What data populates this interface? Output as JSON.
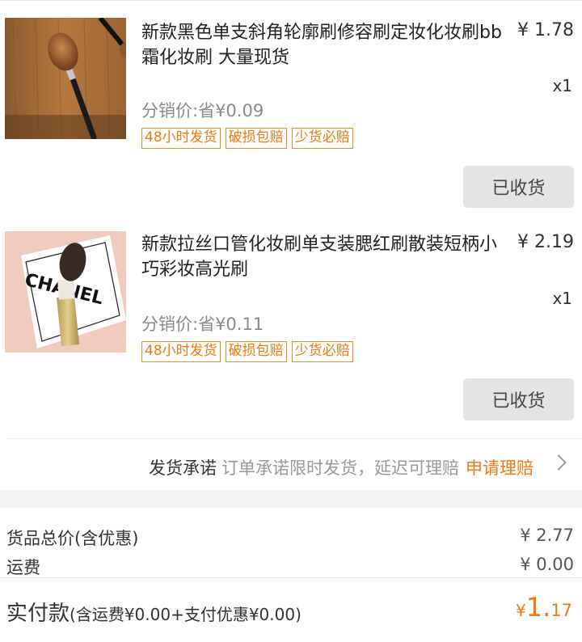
{
  "items": [
    {
      "title": "新款黑色单支斜角轮廓刷修容刷定妆化妆刷bb霜化妆刷 大量现货",
      "price": "¥ 1.78",
      "qty": "x1",
      "commission": "分销价:省¥0.09",
      "badges": [
        "48小时发货",
        "破损包赔",
        "少货必赔"
      ],
      "action": "已收货"
    },
    {
      "title": "新款拉丝口管化妆刷单支装腮红刷散装短柄小巧彩妆高光刷",
      "price": "¥ 2.19",
      "qty": "x1",
      "commission": "分销价:省¥0.11",
      "badges": [
        "48小时发货",
        "破损包赔",
        "少货必赔"
      ],
      "action": "已收货",
      "image_text": "CHANEL"
    }
  ],
  "promise": {
    "label": "发货承诺",
    "desc": "订单承诺限时发货，延迟可理赔",
    "link": "申请理赔"
  },
  "summary": {
    "goods_label": "货品总价(含优惠)",
    "goods_value": "¥ 2.77",
    "shipping_label": "运费",
    "shipping_value": "¥ 0.00",
    "paid_label": "实付款",
    "paid_detail": "(含运费¥0.00+支付优惠¥0.00)",
    "paid_currency": "¥",
    "paid_integer": "1.",
    "paid_decimal": "17"
  },
  "colors": {
    "accent": "#f07a13",
    "badge_border": "#f08a1c",
    "button_bg": "#e4e4e4"
  }
}
